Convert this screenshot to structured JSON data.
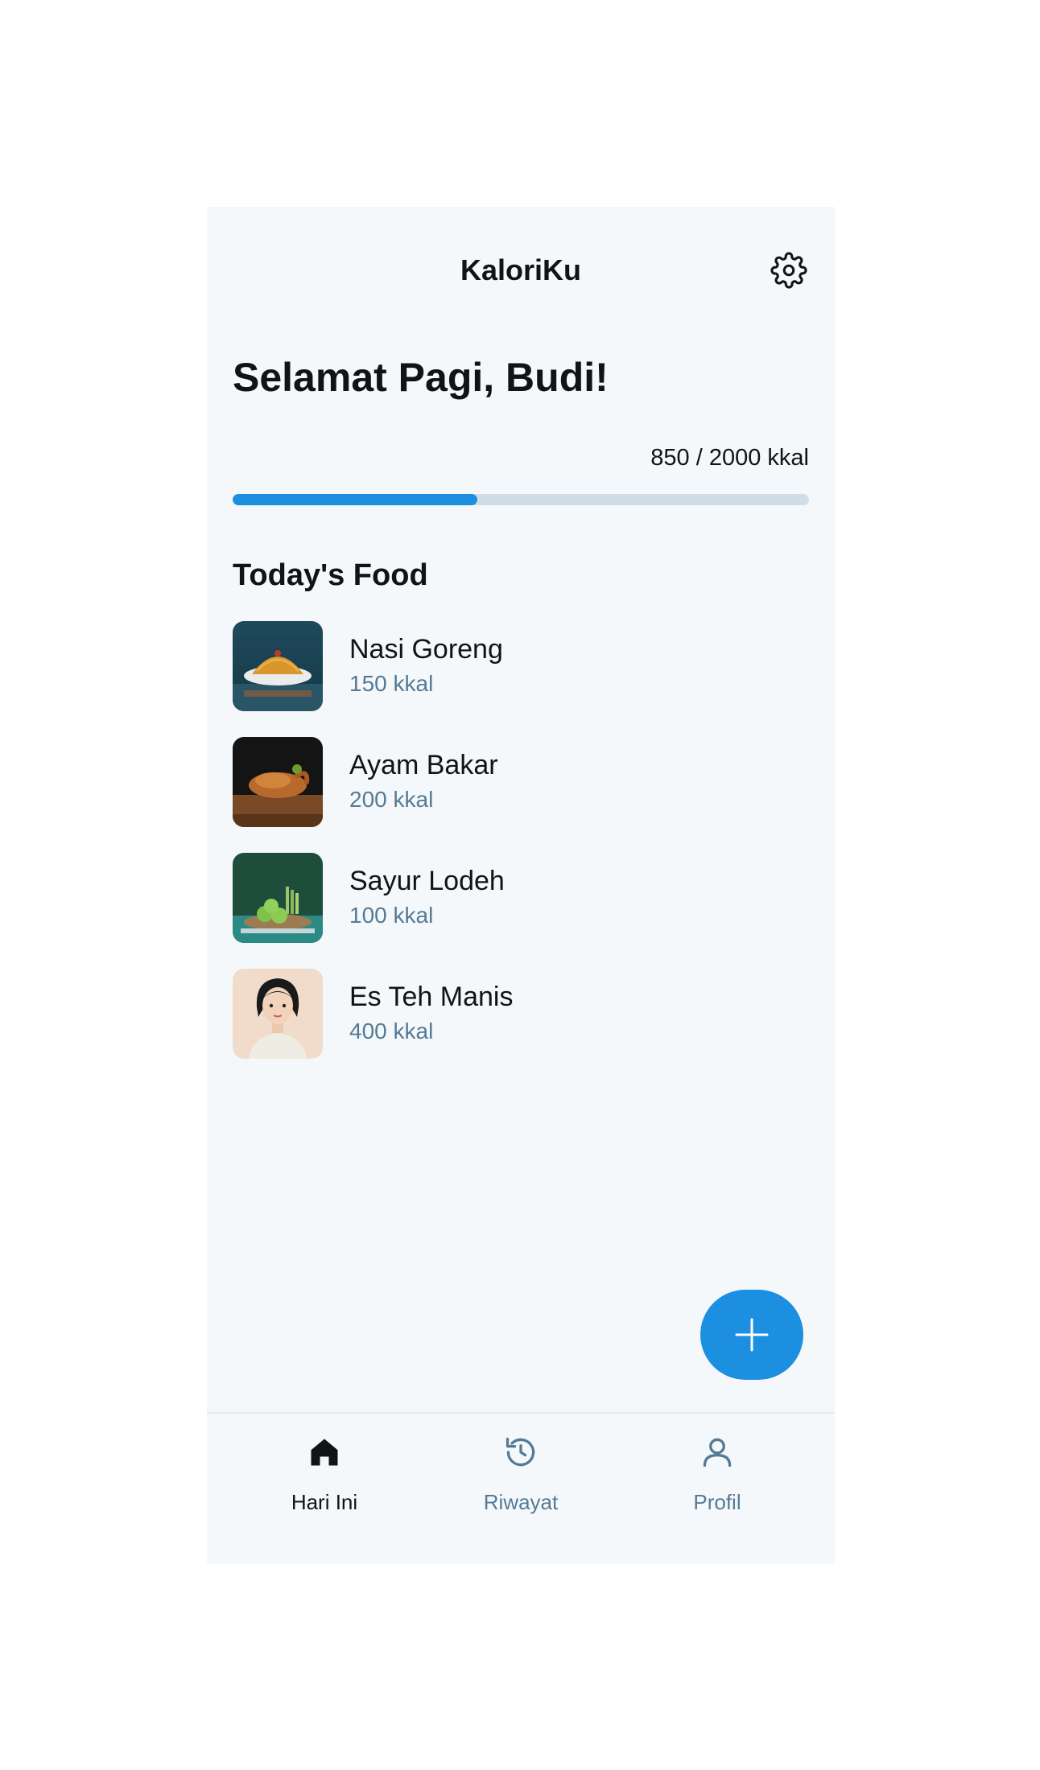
{
  "header": {
    "title": "KaloriKu",
    "settings_icon": "gear-icon"
  },
  "greeting": "Selamat Pagi, Budi!",
  "calories": {
    "consumed": 850,
    "goal": 2000,
    "text": "850 / 2000 kkal",
    "progress_fraction": 0.425
  },
  "section_title": "Today's Food",
  "foods": [
    {
      "name": "Nasi Goreng",
      "kcal": "150 kkal",
      "thumb": "fried-rice-photo"
    },
    {
      "name": "Ayam Bakar",
      "kcal": "200 kkal",
      "thumb": "grilled-chicken-photo"
    },
    {
      "name": "Sayur Lodeh",
      "kcal": "100 kkal",
      "thumb": "vegetables-photo"
    },
    {
      "name": "Es Teh Manis",
      "kcal": "400 kkal",
      "thumb": "portrait-illustration"
    }
  ],
  "fab": {
    "icon": "plus-icon"
  },
  "nav": [
    {
      "label": "Hari Ini",
      "icon": "home-icon",
      "active": true
    },
    {
      "label": "Riwayat",
      "icon": "history-icon",
      "active": false
    },
    {
      "label": "Profil",
      "icon": "user-icon",
      "active": false
    }
  ],
  "colors": {
    "accent": "#1d8fe0",
    "muted": "#557a95",
    "text": "#111417",
    "background": "#f4f8fb"
  }
}
